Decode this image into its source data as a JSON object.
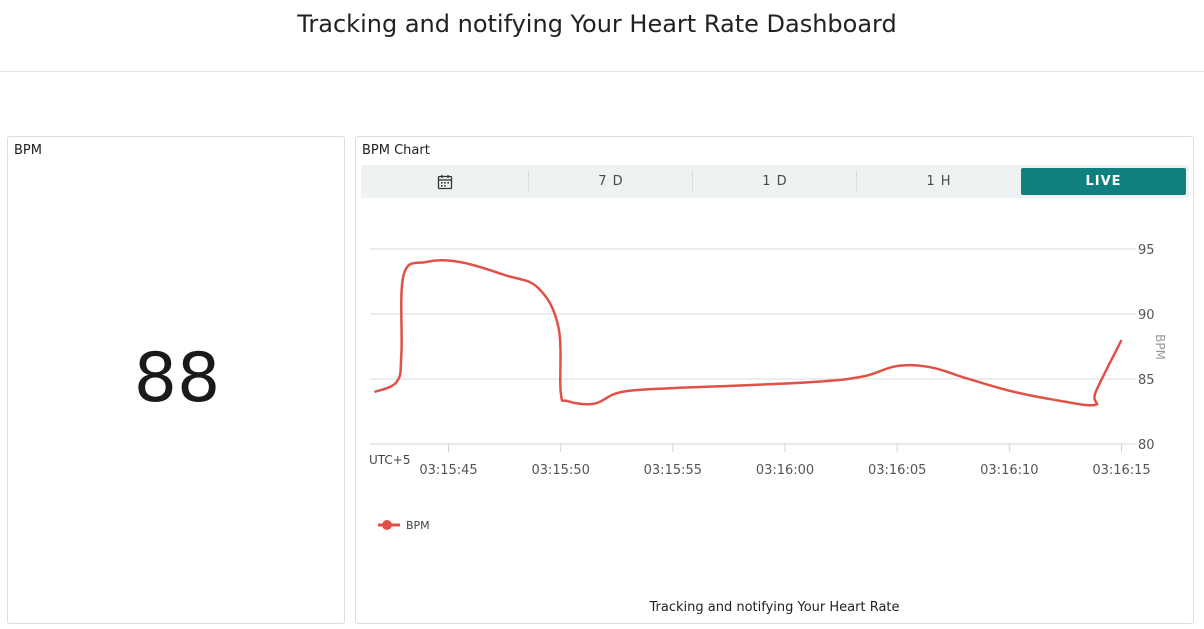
{
  "header": {
    "title": "Tracking and notifying Your Heart Rate Dashboard"
  },
  "value_widget": {
    "title": "BPM",
    "value": "88"
  },
  "chart_widget": {
    "title": "BPM Chart",
    "calendar_icon": "calendar-icon",
    "ranges": [
      "7 D",
      "1 D",
      "1 H",
      "LIVE"
    ],
    "active_range": "LIVE",
    "timezone_label": "UTC+5",
    "legend_label": "BPM",
    "footer": "Tracking and notifying Your Heart Rate"
  },
  "colors": {
    "accent": "#0f7f80",
    "series": "#e05247"
  },
  "chart_data": {
    "type": "line",
    "title": "",
    "ylabel": "BPM",
    "xlabel": "",
    "ylim": [
      80,
      95
    ],
    "yticks": [
      80,
      85,
      90,
      95
    ],
    "x_tick_labels": [
      "03:15:45",
      "03:15:50",
      "03:15:55",
      "03:16:00",
      "03:16:05",
      "03:16:10",
      "03:16:15"
    ],
    "x_range": [
      "03:15:41.5",
      "03:16:15.2"
    ],
    "series": [
      {
        "name": "BPM",
        "x": [
          "03:15:41.7",
          "03:15:42.7",
          "03:15:42.9",
          "03:15:43.0",
          "03:15:44.0",
          "03:15:45.5",
          "03:15:47.5",
          "03:15:49.0",
          "03:15:49.9",
          "03:15:50.0",
          "03:15:50.3",
          "03:15:51.5",
          "03:15:52.7",
          "03:15:55.0",
          "03:15:58.0",
          "03:16:01.5",
          "03:16:03.5",
          "03:16:05.0",
          "03:16:06.5",
          "03:16:08.0",
          "03:16:10.0",
          "03:16:12.0",
          "03:16:13.8",
          "03:16:13.85",
          "03:16:15.0"
        ],
        "values": [
          84,
          84.8,
          87,
          93,
          94,
          94,
          93,
          92,
          89,
          84,
          83.3,
          83.1,
          84,
          84.3,
          84.5,
          84.8,
          85.2,
          86,
          85.9,
          85.1,
          84.1,
          83.4,
          83,
          84,
          88
        ]
      }
    ],
    "legend": "bottom-left",
    "grid": true
  }
}
